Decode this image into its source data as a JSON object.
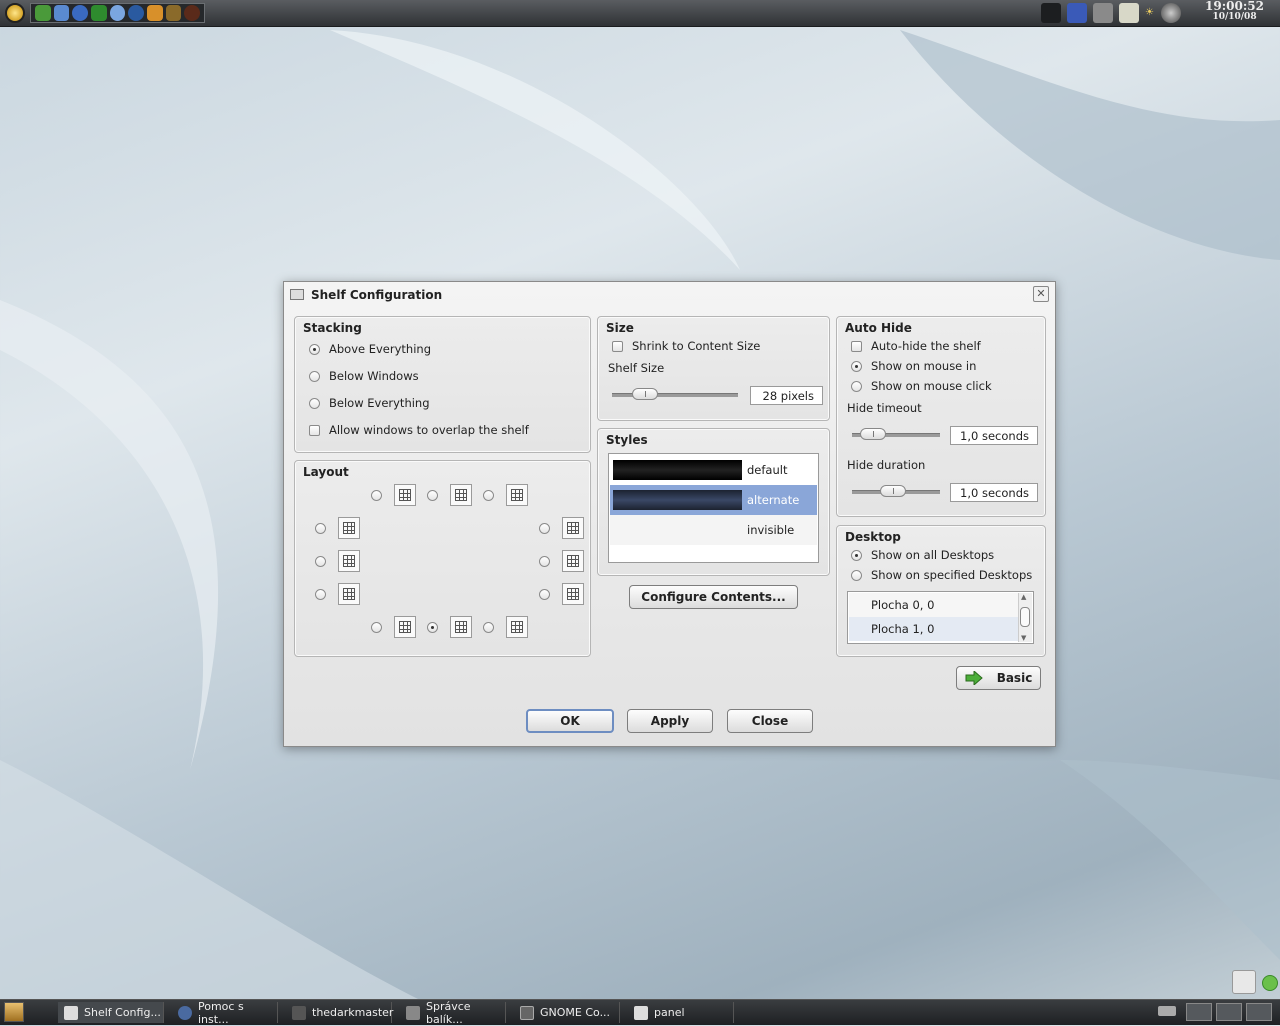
{
  "dialog": {
    "title": "Shelf Configuration",
    "stacking": {
      "title": "Stacking",
      "options": [
        "Above Everything",
        "Below Windows",
        "Below Everything"
      ],
      "selected": "Above Everything",
      "overlap_label": "Allow windows to overlap the shelf"
    },
    "layout": {
      "title": "Layout",
      "selected_position": "bottom-center"
    },
    "size": {
      "title": "Size",
      "shrink_label": "Shrink to Content Size",
      "shelf_size_label": "Shelf Size",
      "shelf_size_value": "28 pixels"
    },
    "styles": {
      "title": "Styles",
      "items": [
        {
          "name": "default",
          "swatch": "#000000"
        },
        {
          "name": "alternate",
          "swatch": "#2a3346"
        },
        {
          "name": "invisible",
          "swatch": ""
        }
      ],
      "selected": "alternate",
      "configure_button": "Configure Contents..."
    },
    "autohide": {
      "title": "Auto Hide",
      "autohide_label": "Auto-hide the shelf",
      "show_mouse_in": "Show on mouse in",
      "show_mouse_click": "Show on mouse click",
      "hide_timeout_label": "Hide timeout",
      "hide_timeout_value": "1,0 seconds",
      "hide_duration_label": "Hide duration",
      "hide_duration_value": "1,0 seconds"
    },
    "desktop": {
      "title": "Desktop",
      "all_label": "Show on all Desktops",
      "specified_label": "Show on specified Desktops",
      "desktops": [
        "Plocha 0, 0",
        "Plocha 1, 0"
      ]
    },
    "basic_button": "Basic",
    "ok_button": "OK",
    "apply_button": "Apply",
    "close_button": "Close"
  },
  "top_panel": {
    "time": "19:00:52",
    "date": "10/10/08"
  },
  "taskbar": {
    "tasks": [
      "Shelf Config...",
      "Pomoc s inst...",
      "thedarkmaster",
      "Správce balík...",
      "GNOME Co...",
      "panel"
    ]
  },
  "colors": {
    "selection": "#8aa6d8",
    "default_button_border": "#6d8dc1",
    "panel": "#2f3235"
  }
}
